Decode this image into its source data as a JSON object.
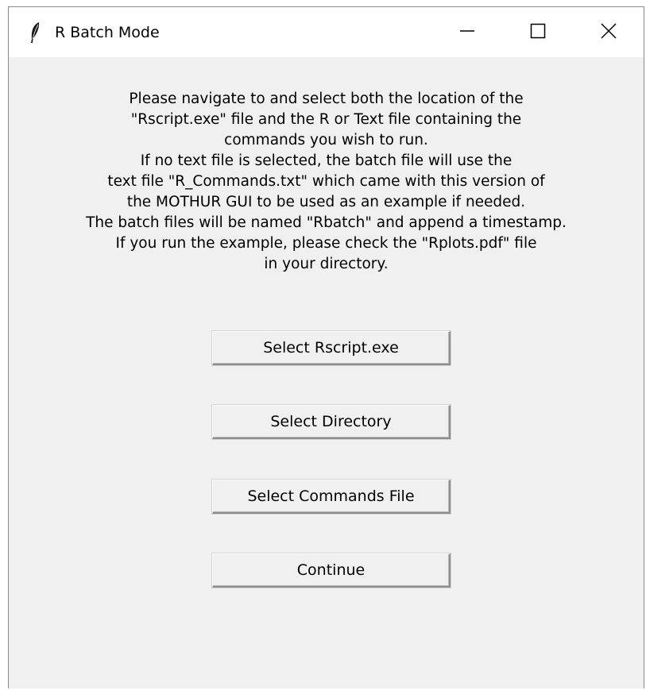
{
  "window": {
    "title": "R Batch Mode",
    "controls": {
      "minimize": "minimize-icon",
      "maximize": "maximize-icon",
      "close": "close-icon"
    },
    "app_icon": "feather-icon"
  },
  "message": {
    "lines": [
      "Please navigate to and select both the location of the",
      "\"Rscript.exe\" file and the R or Text file containing the",
      "commands you wish to run.",
      "If no text file is selected, the batch file will use the",
      "text file \"R_Commands.txt\" which came with this version of",
      "the MOTHUR GUI to be used as an example if needed.",
      "The batch files will be named \"Rbatch\" and append a timestamp.",
      "If you run the example, please check the \"Rplots.pdf\" file",
      "in your directory."
    ]
  },
  "buttons": {
    "select_rscript": "Select Rscript.exe",
    "select_directory": "Select Directory",
    "select_commands_file": "Select Commands File",
    "continue": "Continue"
  }
}
